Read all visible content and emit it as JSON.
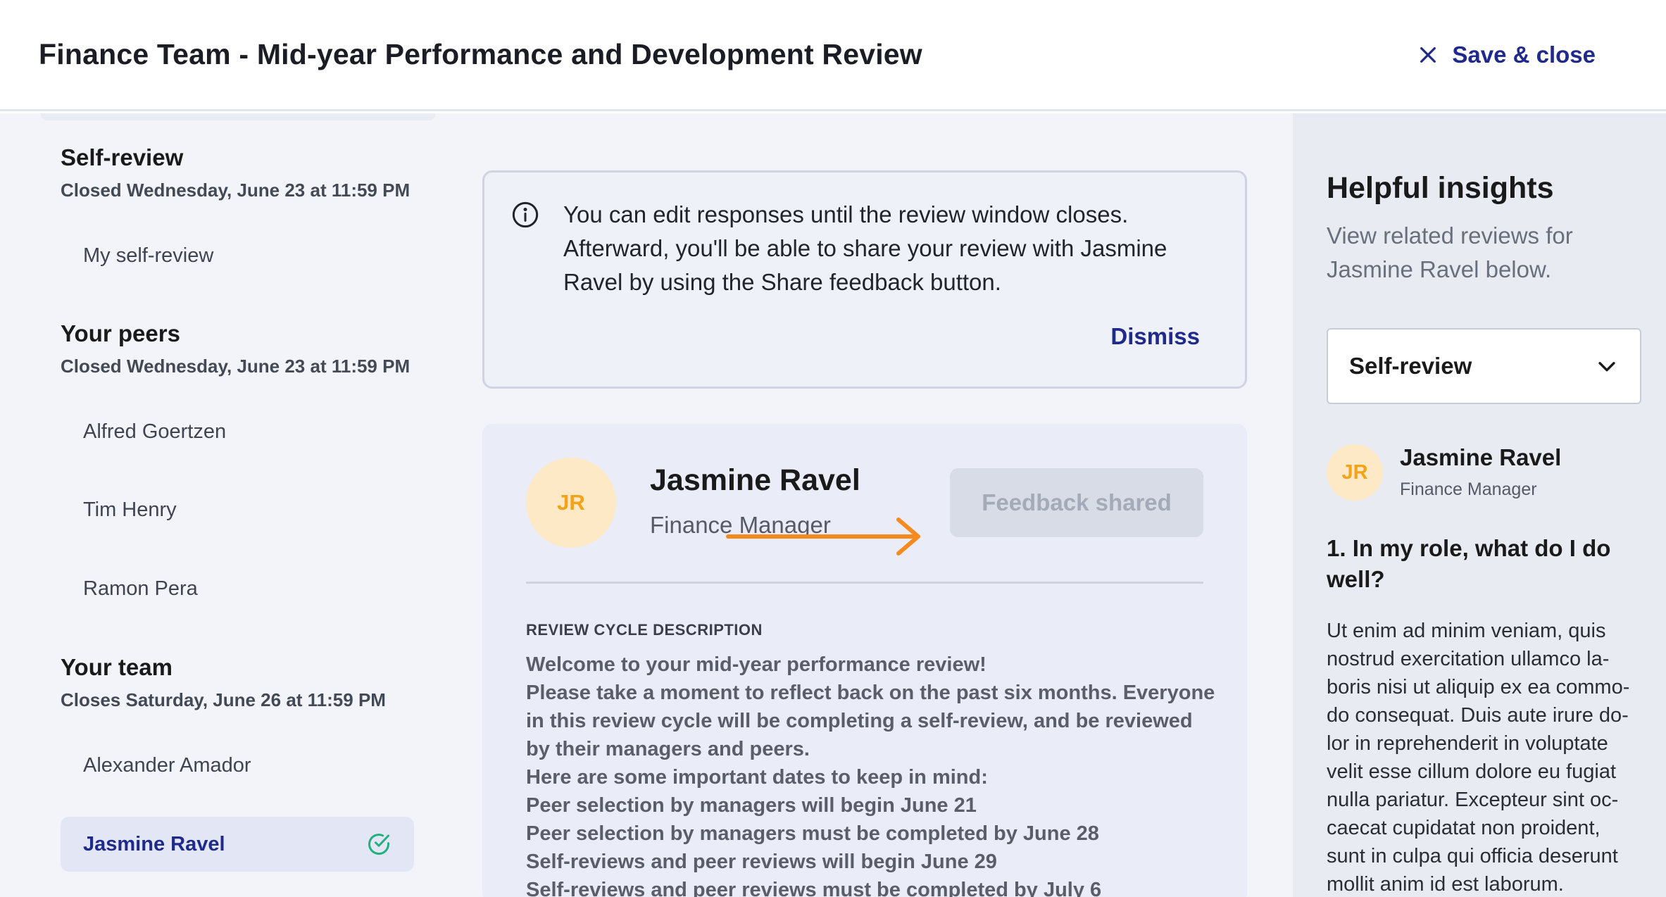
{
  "header": {
    "title": "Finance Team - Mid-year Performance and Development Review",
    "save_close_label": "Save & close"
  },
  "sidebar": {
    "groups": [
      {
        "title": "Self-review",
        "subtitle": "Closed Wednesday, June 23 at 11:59 PM",
        "items": [
          {
            "label": "My self-review"
          }
        ]
      },
      {
        "title": "Your peers",
        "subtitle": "Closed Wednesday, June 23 at 11:59 PM",
        "items": [
          {
            "label": "Alfred Goertzen"
          },
          {
            "label": "Tim Henry"
          },
          {
            "label": "Ramon Pera"
          }
        ]
      },
      {
        "title": "Your team",
        "subtitle": "Closes Saturday, June 26 at 11:59 PM",
        "items": [
          {
            "label": "Alexander Amador"
          },
          {
            "label": "Jasmine Ravel",
            "active": true,
            "completed": true
          }
        ]
      }
    ]
  },
  "notice": {
    "lines": [
      "You can edit responses until the review window closes.",
      "Afterward, you'll be able to share your review with Jasmine",
      "Ravel by using the Share feedback button."
    ],
    "dismiss_label": "Dismiss"
  },
  "profile": {
    "initials": "JR",
    "name": "Jasmine Ravel",
    "role": "Finance Manager",
    "feedback_button_label": "Feedback shared",
    "description_label": "REVIEW CYCLE DESCRIPTION",
    "description_lines": [
      "Welcome to your mid-year performance review!",
      "Please take a moment to reflect back on the past six months. Everyone",
      "in this review cycle will be completing a self-review, and be reviewed",
      "by their managers and peers.",
      "Here are some important dates to keep in mind:",
      "Peer selection by managers will begin June 21",
      "Peer selection by managers must be completed by June 28",
      "Self-reviews and peer reviews will begin June 29",
      "Self-reviews and peer reviews must be completed by July 6"
    ]
  },
  "insights": {
    "title": "Helpful insights",
    "subtitle_lines": [
      "View related reviews for",
      "Jasmine Ravel below."
    ],
    "select_value": "Self-review",
    "reviewer_initials": "JR",
    "reviewer_name": "Jasmine Ravel",
    "reviewer_role": "Finance Manager",
    "question_lines": [
      "1. In my role, what do I do",
      "well?"
    ],
    "answer_lines": [
      "Ut enim ad minim veniam, quis",
      "nostrud exercitation ullamco la-",
      "boris nisi ut aliquip ex ea commo-",
      "do consequat. Duis aute irure do-",
      "lor in reprehenderit in voluptate",
      "velit esse cillum dolore eu fugiat",
      "nulla pariatur. Excepteur sint oc-",
      "caecat cupidatat non proident,",
      "sunt in culpa qui officia deserunt",
      "mollit anim id est laborum."
    ]
  },
  "colors": {
    "brand": "#1f2a8a",
    "avatar_bg": "#fde9c6",
    "avatar_text": "#f4a21a",
    "arrow": "#f58a1f",
    "success": "#22b07d"
  }
}
